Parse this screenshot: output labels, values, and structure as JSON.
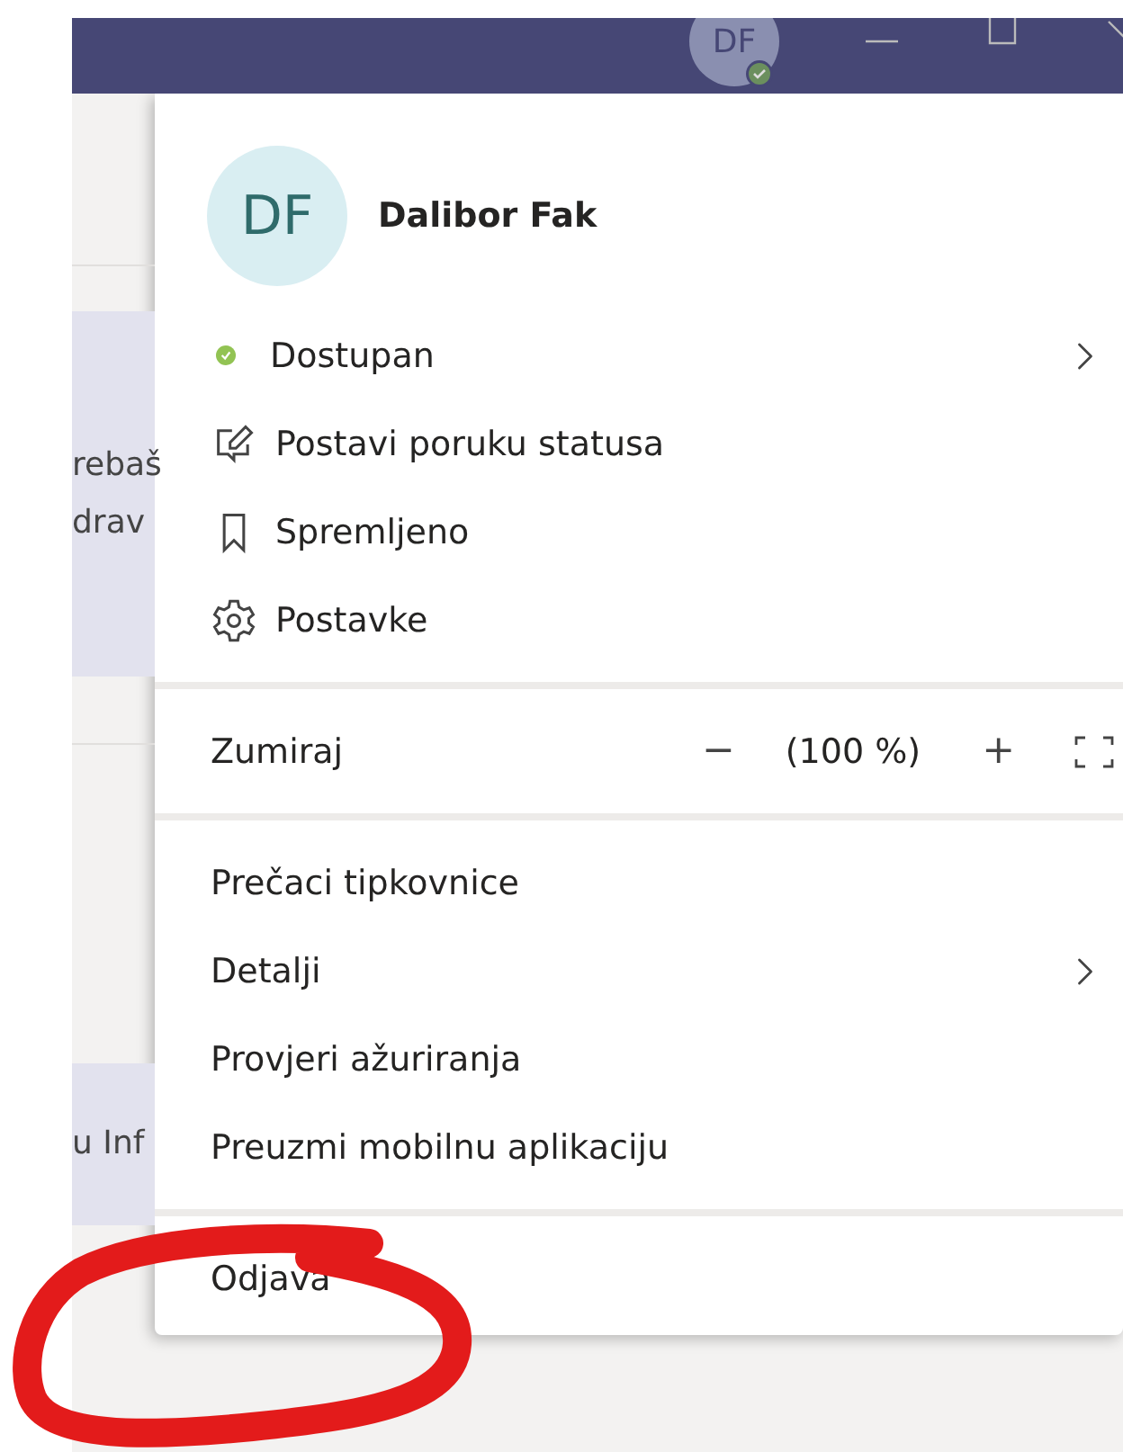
{
  "title_bar": {
    "avatar_initials": "DF"
  },
  "background": {
    "card_lines": [
      "rebaš",
      "drav"
    ],
    "lower_card_text": "u Inf"
  },
  "menu": {
    "profile": {
      "initials": "DF",
      "name": "Dalibor Fak"
    },
    "sections": [
      [
        {
          "kind": "status",
          "label": "Dostupan",
          "color": "#92c353",
          "submenu": true
        },
        {
          "kind": "edit",
          "label": "Postavi poruku statusa",
          "submenu": false
        },
        {
          "kind": "bookmark",
          "label": "Spremljeno",
          "submenu": false
        },
        {
          "kind": "gear",
          "label": "Postavke",
          "submenu": false
        }
      ],
      [
        {
          "kind": "zoom",
          "label": "Zumiraj",
          "minus": "−",
          "value": "(100 %)",
          "plus": "+"
        }
      ],
      [
        {
          "kind": "plain",
          "label": "Prečaci tipkovnice",
          "submenu": false
        },
        {
          "kind": "plain",
          "label": "Detalji",
          "submenu": true
        },
        {
          "kind": "plain",
          "label": "Provjeri ažuriranja",
          "submenu": false
        },
        {
          "kind": "plain",
          "label": "Preuzmi mobilnu aplikaciju",
          "submenu": false
        }
      ],
      [
        {
          "kind": "plain",
          "label": "Odjava",
          "submenu": false
        }
      ]
    ]
  }
}
